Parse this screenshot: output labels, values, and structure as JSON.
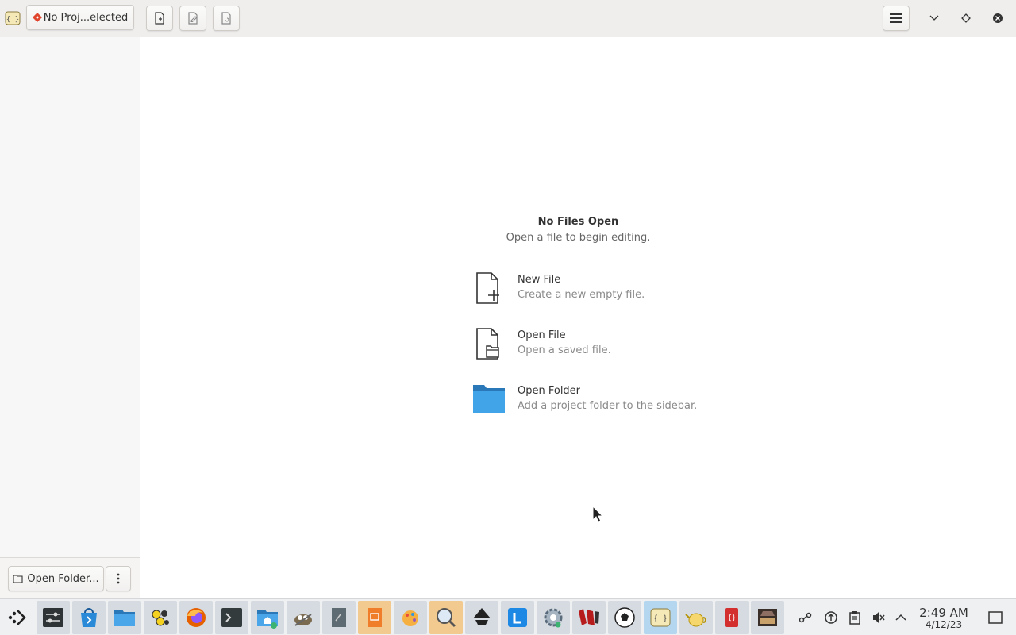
{
  "header": {
    "project_label": "No Proj...elected"
  },
  "sidebar": {
    "open_folder_label": "Open Folder..."
  },
  "welcome": {
    "title": "No Files Open",
    "subtitle": "Open a file to begin editing.",
    "actions": [
      {
        "title": "New File",
        "desc": "Create a new empty file.",
        "icon": "new-file-icon"
      },
      {
        "title": "Open File",
        "desc": "Open a saved file.",
        "icon": "open-file-icon"
      },
      {
        "title": "Open Folder",
        "desc": "Add a project folder to the sidebar.",
        "icon": "folder-icon"
      }
    ]
  },
  "taskbar": {
    "time": "2:49 AM",
    "date": "4/12/23",
    "apps": [
      "app-launcher",
      "settings",
      "app-store",
      "files",
      "colors",
      "firefox",
      "terminal",
      "home-folder",
      "gimp",
      "text-document",
      "presentation",
      "paint",
      "search-tool",
      "inkscape",
      "tasks",
      "settings-gear",
      "game",
      "soccer",
      "code-editor-active",
      "teapot",
      "book",
      "archive"
    ]
  },
  "colors": {
    "accent_folder": "#3a8ed3",
    "taskbar_highlight": "#f2c98f",
    "taskbar_selected": "#b5d6ef"
  }
}
